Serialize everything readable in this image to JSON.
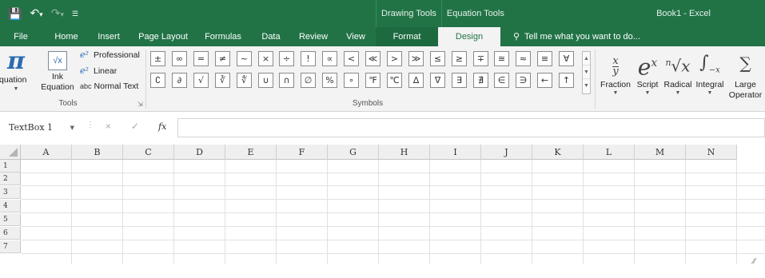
{
  "titlebar": {
    "qat": {
      "save_icon": "save-icon",
      "undo_icon": "undo-icon",
      "redo_icon": "redo-icon",
      "customize_icon": "customize-qat-icon"
    },
    "contextual_tools": [
      "Drawing Tools",
      "Equation Tools"
    ],
    "doc_title": "Book1 - Excel"
  },
  "tabs": [
    {
      "label": "File"
    },
    {
      "label": "Home"
    },
    {
      "label": "Insert"
    },
    {
      "label": "Page Layout"
    },
    {
      "label": "Formulas"
    },
    {
      "label": "Data"
    },
    {
      "label": "Review"
    },
    {
      "label": "View"
    },
    {
      "label": "Format"
    },
    {
      "label": "Design"
    }
  ],
  "active_tab": "Design",
  "tell_me": "Tell me what you want to do...",
  "ribbon": {
    "tools_group": {
      "label": "Tools",
      "equation": "Equation",
      "ink_equation_line1": "Ink",
      "ink_equation_line2": "Equation",
      "professional": "Professional",
      "linear": "Linear",
      "normal_text": "Normal Text",
      "normal_text_prefix": "abc"
    },
    "symbols_group": {
      "label": "Symbols",
      "row1": [
        "±",
        "∞",
        "=",
        "≠",
        "~",
        "×",
        "÷",
        "!",
        "∝",
        "<",
        "≪",
        ">",
        "≫",
        "≤",
        "≥",
        "∓",
        "≅",
        "≈",
        "≡",
        "∀"
      ],
      "row2": [
        "∁",
        "∂",
        "√",
        "∛",
        "∜",
        "∪",
        "∩",
        "∅",
        "%",
        "∘",
        "℉",
        "℃",
        "∆",
        "∇",
        "∃",
        "∄",
        "∈",
        "∋",
        "←",
        "↑"
      ]
    },
    "structures": [
      {
        "label": "Fraction",
        "glyph": "x⁄y"
      },
      {
        "label": "Script",
        "glyph": "eˣ"
      },
      {
        "label": "Radical",
        "glyph": "ⁿ√x"
      },
      {
        "label": "Integral",
        "glyph": "∫"
      },
      {
        "label": "Large Operator",
        "label_line1": "Large",
        "label_line2": "Operator",
        "glyph": "∑"
      }
    ]
  },
  "formula_bar": {
    "name_box": "TextBox 1",
    "cancel": "×",
    "enter": "✓",
    "fx": "fx",
    "value": ""
  },
  "sheet": {
    "columns": [
      "A",
      "B",
      "C",
      "D",
      "E",
      "F",
      "G",
      "H",
      "I",
      "J",
      "K",
      "L",
      "M",
      "N"
    ],
    "rows": [
      "1",
      "2",
      "3",
      "4",
      "5",
      "6",
      "7"
    ]
  },
  "colors": {
    "excel_green": "#217346",
    "ribbon_bg": "#f3f3f3"
  }
}
